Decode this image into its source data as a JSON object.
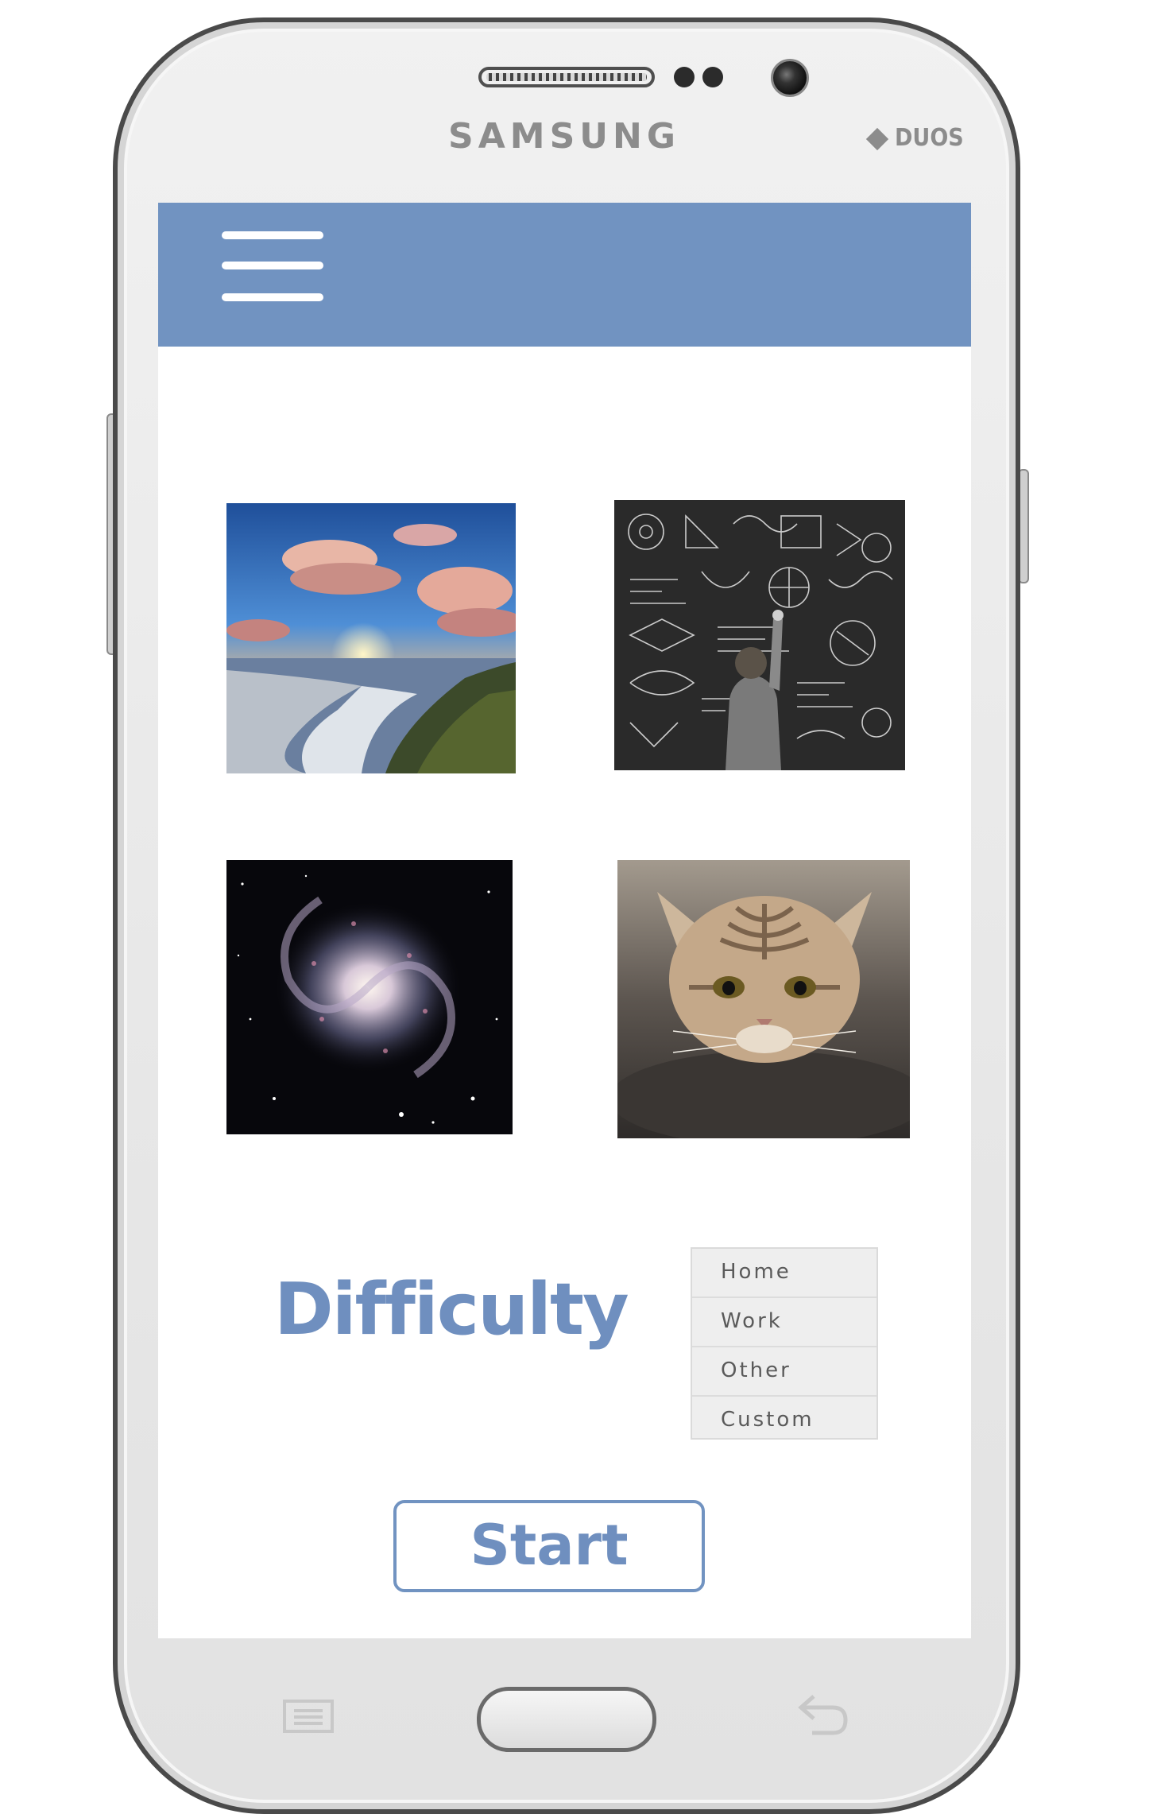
{
  "device": {
    "brand": "SAMSUNG",
    "model_badge": "DUOS"
  },
  "app_bar": {
    "color": "#7193c1",
    "menu_icon": "hamburger-menu-icon"
  },
  "gallery": {
    "images": [
      {
        "name": "beach-sunset-image",
        "subject": "beach-sunset"
      },
      {
        "name": "chalkboard-image",
        "subject": "chalkboard"
      },
      {
        "name": "galaxy-image",
        "subject": "galaxy"
      },
      {
        "name": "cat-image",
        "subject": "cat"
      }
    ]
  },
  "difficulty": {
    "label": "Difficulty",
    "options": [
      "Home",
      "Work",
      "Other",
      "Custom"
    ]
  },
  "start_button": {
    "label": "Start"
  },
  "colors": {
    "accent": "#6f8fbf",
    "dropdown_bg": "#eeeeee"
  }
}
